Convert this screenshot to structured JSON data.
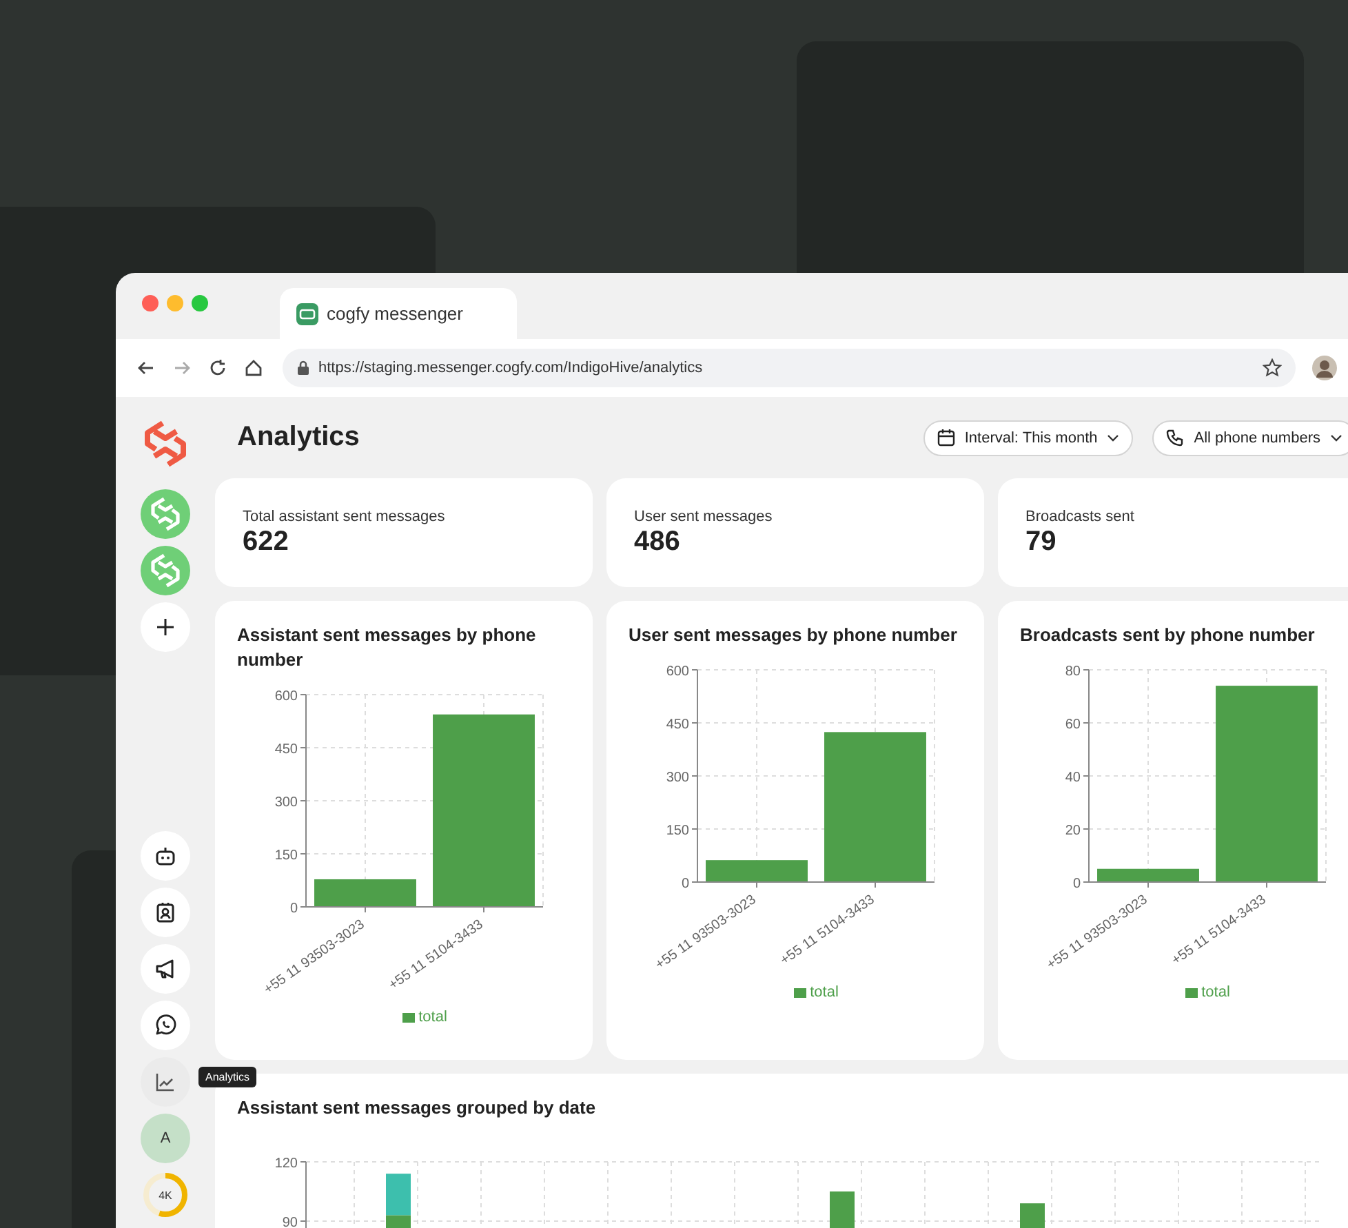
{
  "browser": {
    "tab_title": "cogfy messenger",
    "url": "https://staging.messenger.cogfy.com/IndigoHive/analytics"
  },
  "sidebar": {
    "nav": [
      {
        "kind": "bot",
        "selected": false
      },
      {
        "kind": "contacts",
        "selected": false
      },
      {
        "kind": "broadcast",
        "selected": false
      },
      {
        "kind": "whatsapp",
        "selected": false
      },
      {
        "kind": "analytics",
        "selected": true
      }
    ],
    "tooltip": "Analytics",
    "user_initial": "A",
    "usage": {
      "label": "4K",
      "level": 0.55
    }
  },
  "page": {
    "title": "Analytics",
    "filters": [
      {
        "kind": "calendar",
        "label": "Interval: This month"
      },
      {
        "kind": "phone",
        "label": "All phone numbers"
      }
    ]
  },
  "stats": [
    {
      "label": "Total assistant sent messages",
      "value": "622"
    },
    {
      "label": "User sent messages",
      "value": "486"
    },
    {
      "label": "Broadcasts sent",
      "value": "79"
    }
  ],
  "charts": [
    {
      "title": "Assistant sent messages by phone number",
      "chart_data": {
        "type": "bar",
        "categories": [
          "+55 11 93503-3023",
          "+55 11 5104-3433"
        ],
        "series": [
          {
            "name": "total",
            "color": "#4e9f4a",
            "values": [
              78,
              544
            ]
          }
        ],
        "grid": true,
        "ylim": [
          0,
          600
        ],
        "yticks": [
          0,
          150,
          300,
          450,
          600
        ]
      }
    },
    {
      "title": "User sent messages by phone number",
      "chart_data": {
        "type": "bar",
        "categories": [
          "+55 11 93503-3023",
          "+55 11 5104-3433"
        ],
        "series": [
          {
            "name": "total",
            "color": "#4e9f4a",
            "values": [
              62,
              424
            ]
          }
        ],
        "grid": true,
        "ylim": [
          0,
          600
        ],
        "yticks": [
          0,
          150,
          300,
          450,
          600
        ]
      }
    },
    {
      "title": "Broadcasts sent by phone number",
      "chart_data": {
        "type": "bar",
        "categories": [
          "+55 11 93503-3023",
          "+55 11 5104-3433"
        ],
        "series": [
          {
            "name": "total",
            "color": "#4e9f4a",
            "values": [
              5,
              74
            ]
          }
        ],
        "grid": true,
        "ylim": [
          0,
          80
        ],
        "yticks": [
          0,
          20,
          40,
          60,
          80
        ]
      }
    }
  ],
  "date_chart": {
    "title": "Assistant sent messages grouped by date",
    "chart_data": {
      "type": "bar",
      "stacked": true,
      "grid": true,
      "ylim": [
        0,
        120
      ],
      "yticks": [
        90,
        120
      ],
      "series": [
        {
          "color": "#4e9f4a",
          "values": [
            null,
            93,
            null,
            null,
            null,
            null,
            null,
            null,
            105,
            null,
            null,
            99,
            null,
            null,
            null,
            null
          ]
        },
        {
          "color": "#3dbfad",
          "values": [
            null,
            21,
            null,
            null,
            null,
            null,
            null,
            null,
            null,
            null,
            null,
            null,
            null,
            null,
            null,
            null
          ]
        }
      ]
    }
  }
}
